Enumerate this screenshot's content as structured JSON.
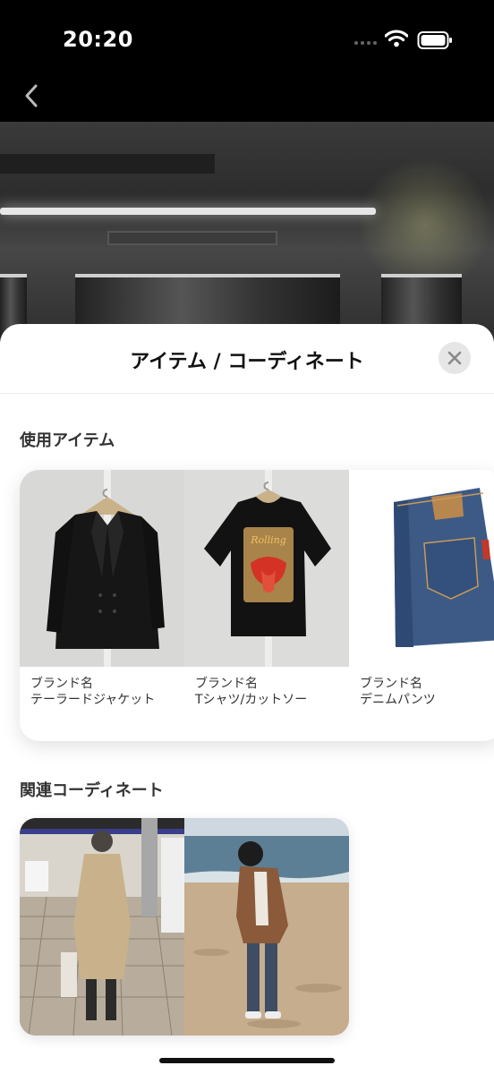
{
  "status": {
    "time": "20:20"
  },
  "sheet": {
    "title": "アイテム / コーディネート",
    "items_section_title": "使用アイテム",
    "coordinates_section_title": "関連コーディネート"
  },
  "items": [
    {
      "brand": "ブランド名",
      "name": "テーラードジャケット",
      "icon": "jacket-photo"
    },
    {
      "brand": "ブランド名",
      "name": "Tシャツ/カットソー",
      "icon": "tshirt-photo"
    },
    {
      "brand": "ブランド名",
      "name": "デニムパンツ",
      "icon": "denim-photo"
    }
  ],
  "coordinates": [
    {
      "icon": "station-coordinate-photo"
    },
    {
      "icon": "beach-coordinate-photo"
    }
  ],
  "colors": {
    "sheet_bg": "#ffffff",
    "accent_text": "#111111",
    "close_bg": "#e6e6e6"
  }
}
